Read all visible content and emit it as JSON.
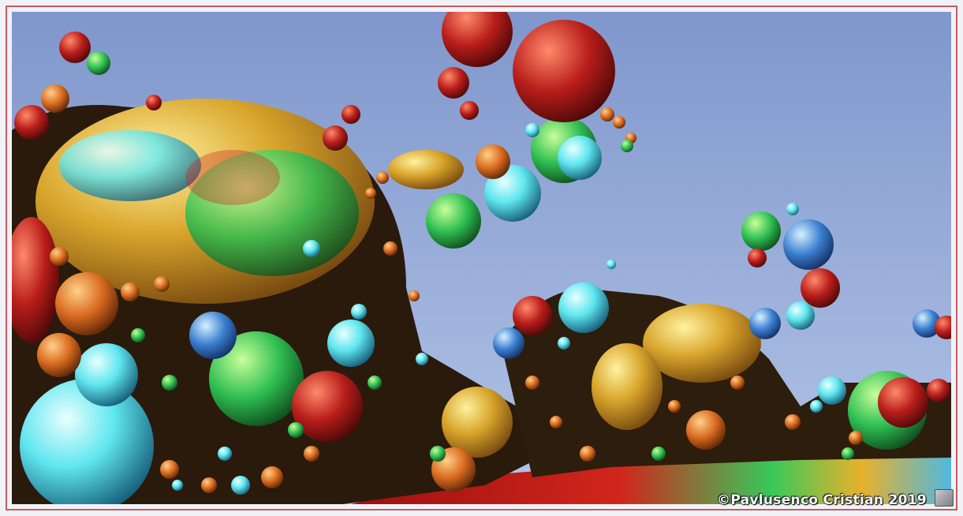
{
  "artwork": {
    "kind": "3D fractal render of clustered glossy spheres against a blue sky",
    "watermark": "©Pavlusenco Cristian 2019",
    "badge_icon": "signature-badge-icon",
    "colors": {
      "frame": "#f2f2f6",
      "frame_line": "#c65a64",
      "sky_top": "#7f97cc",
      "sky_bottom": "#b3c4e6",
      "accent_red": "#c8221e",
      "accent_green": "#2fbf52",
      "accent_cyan": "#5fe6ef",
      "accent_gold": "#d9a52c"
    }
  }
}
